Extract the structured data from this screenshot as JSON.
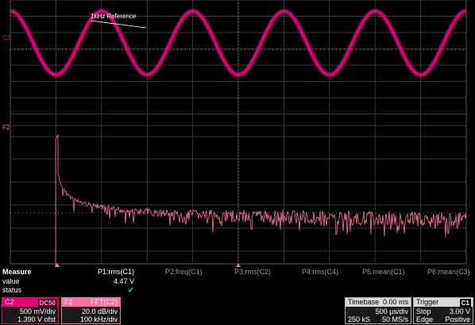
{
  "colors": {
    "c2": "#e8007a",
    "f2": "#ff6fa0",
    "grid": "#555555",
    "background": "#000000"
  },
  "waveform": {
    "label": "1kHz Reference",
    "c2_marker": "C2",
    "f2_marker": "F2",
    "c2_amplitude_div": 2.3,
    "c2_offset_div": -2.95,
    "cycles_on_screen": 5,
    "grid_divisions": {
      "x": 10,
      "y": 8
    }
  },
  "measure": {
    "header": "Measure",
    "row_value_label": "value",
    "row_status_label": "status",
    "params": [
      {
        "name": "P1:rms(C1)",
        "value": "4.47 V",
        "status": "✔",
        "active": true
      },
      {
        "name": "P2:freq(C1)",
        "value": "",
        "status": "",
        "active": false
      },
      {
        "name": "P3:rms(C2)",
        "value": "",
        "status": "",
        "active": false
      },
      {
        "name": "P4:rms(C4)",
        "value": "",
        "status": "",
        "active": false
      },
      {
        "name": "P5:mean(C1)",
        "value": "",
        "status": "",
        "active": false
      },
      {
        "name": "P6:mean(C3)",
        "value": "",
        "status": "",
        "active": false
      }
    ]
  },
  "channels": {
    "c2": {
      "name": "C2",
      "coupling": "DC50",
      "vdiv": "500 mV/div",
      "offset": "1.390 V ofst"
    },
    "f2": {
      "name": "F2",
      "function": "FFT(C2)",
      "vdiv": "20.0 dB/div",
      "hdiv": "100 kHz/div"
    }
  },
  "timebase": {
    "title": "Timebase",
    "delay": "0.00 ms",
    "tdiv": "500 µs/div",
    "samples": "250 kS",
    "rate": "50 MS/s"
  },
  "trigger": {
    "title": "Trigger",
    "source": "C1",
    "mode": "Stop",
    "level": "3.00 V",
    "type": "Edge",
    "slope": "Positive"
  }
}
